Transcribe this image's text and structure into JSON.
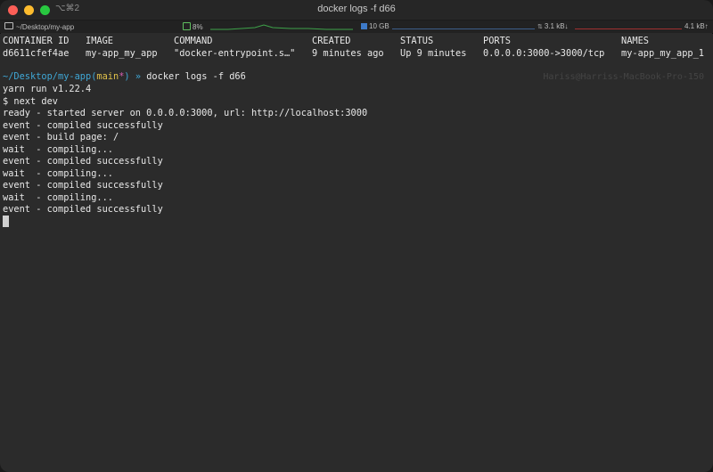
{
  "window": {
    "title": "docker logs -f d66",
    "shortcut": "⌥⌘2"
  },
  "statusbar": {
    "path": "~/Desktop/my-app",
    "cpu": "8%",
    "memory": "10 GB",
    "net_down": "3.1 kB↓",
    "net_up": "4.1 kB↑"
  },
  "docker_ps": {
    "headers": [
      "CONTAINER ID",
      "IMAGE",
      "COMMAND",
      "CREATED",
      "STATUS",
      "PORTS",
      "NAMES"
    ],
    "row": [
      "d6611cfef4ae",
      "my-app_my_app",
      "\"docker-entrypoint.s…\"",
      "9 minutes ago",
      "Up 9 minutes",
      "0.0.0.0:3000->3000/tcp",
      "my-app_my_app_1"
    ]
  },
  "prompt": {
    "path": "~/Desktop/my-app",
    "branch_open": "(",
    "branch": "main",
    "dirty": "*",
    "branch_close": ")",
    "arrow": " » ",
    "command": "docker logs -f d66",
    "hostname": "Hariss@Harriss-MacBook-Pro-150"
  },
  "output": [
    "yarn run v1.22.4",
    "$ next dev",
    "ready - started server on 0.0.0.0:3000, url: http://localhost:3000",
    "event - compiled successfully",
    "event - build page: /",
    "wait  - compiling...",
    "event - compiled successfully",
    "wait  - compiling...",
    "event - compiled successfully",
    "wait  - compiling...",
    "event - compiled successfully"
  ]
}
